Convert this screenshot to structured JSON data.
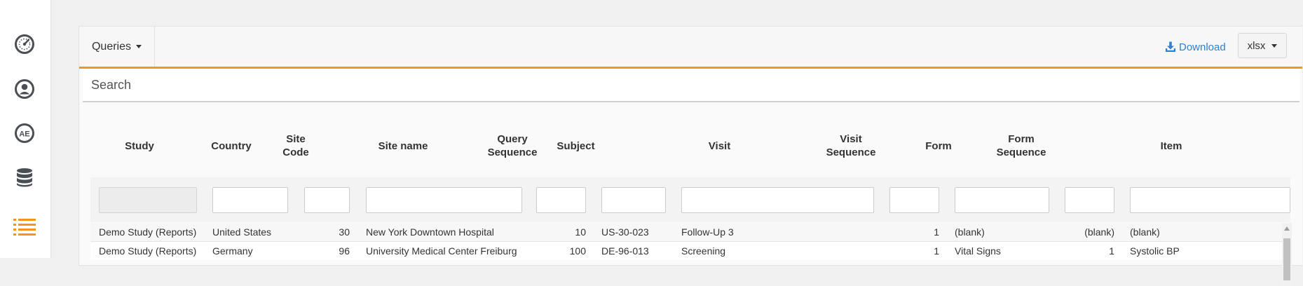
{
  "sidebar": {
    "items": [
      {
        "icon": "gauge-icon",
        "label": "",
        "active": false
      },
      {
        "icon": "user-icon",
        "label": "",
        "active": false
      },
      {
        "icon": "ae-icon",
        "label": "AE",
        "active": false
      },
      {
        "icon": "database-icon",
        "label": "",
        "active": false
      },
      {
        "icon": "list-icon",
        "label": "",
        "active": true
      }
    ]
  },
  "toolbar": {
    "queries_label": "Queries",
    "download_label": "Download",
    "format_value": "xlsx"
  },
  "search": {
    "placeholder": "Search"
  },
  "table": {
    "columns": [
      "Study",
      "Country",
      "Site Code",
      "Site name",
      "Query Sequence",
      "Subject",
      "Visit",
      "Visit Sequence",
      "Form",
      "Form Sequence",
      "Item"
    ],
    "rows": [
      [
        "Demo Study (Reports)",
        "United States",
        "30",
        "New York Downtown Hospital",
        "10",
        "US-30-023",
        "Follow-Up 3",
        "1",
        "(blank)",
        "(blank)",
        "(blank)"
      ],
      [
        "Demo Study (Reports)",
        "Germany",
        "96",
        "University Medical Center Freiburg",
        "100",
        "DE-96-013",
        "Screening",
        "1",
        "Vital Signs",
        "1",
        "Systolic BP"
      ]
    ]
  },
  "colors": {
    "accent": "#f7931e",
    "link": "#2f80d1",
    "icon": "#4a4f55"
  }
}
